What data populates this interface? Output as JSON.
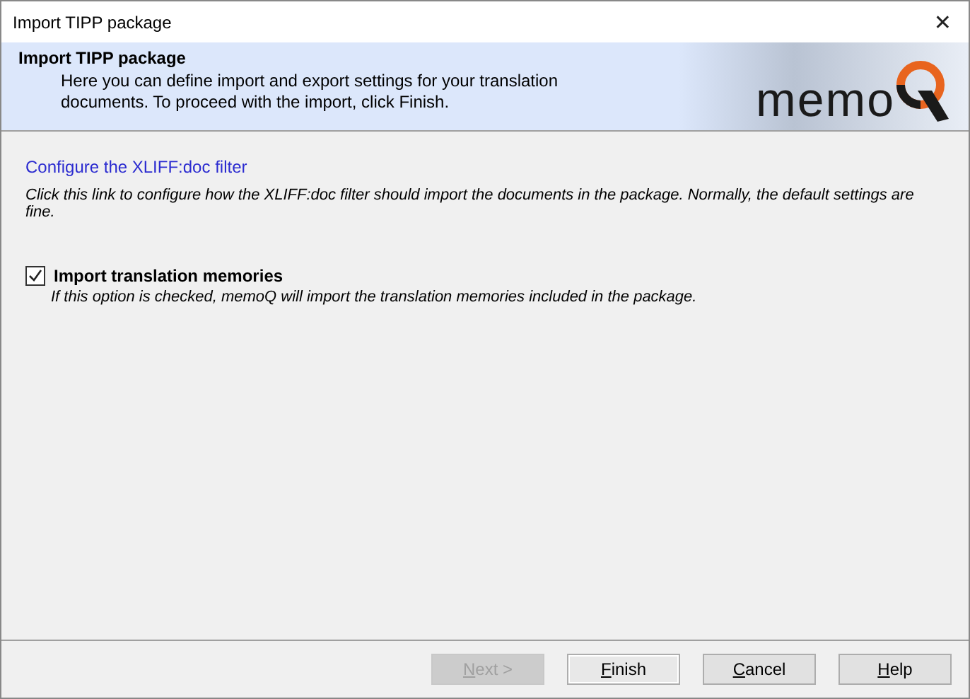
{
  "window": {
    "title": "Import TIPP package",
    "close": "✕"
  },
  "header": {
    "title": "Import TIPP package",
    "description": "Here you can define import and export settings for your translation documents. To proceed with the import, click Finish.",
    "logo_text": "memo"
  },
  "filter_link": {
    "label": "Configure the XLIFF:doc filter",
    "hint": "Click this link to configure how the XLIFF:doc filter should import the documents in the package. Normally, the default settings are fine."
  },
  "options": [
    {
      "label": "Import translation memories",
      "checked": true,
      "hint": "If this option is checked, memoQ will import the translation memories included in the package."
    }
  ],
  "buttons": [
    {
      "label": "Next >",
      "disabled": true,
      "selected": false
    },
    {
      "label": "Finish",
      "disabled": false,
      "selected": true
    },
    {
      "label": "Cancel",
      "disabled": false,
      "selected": false
    },
    {
      "label": "Help",
      "disabled": false,
      "selected": false
    }
  ]
}
